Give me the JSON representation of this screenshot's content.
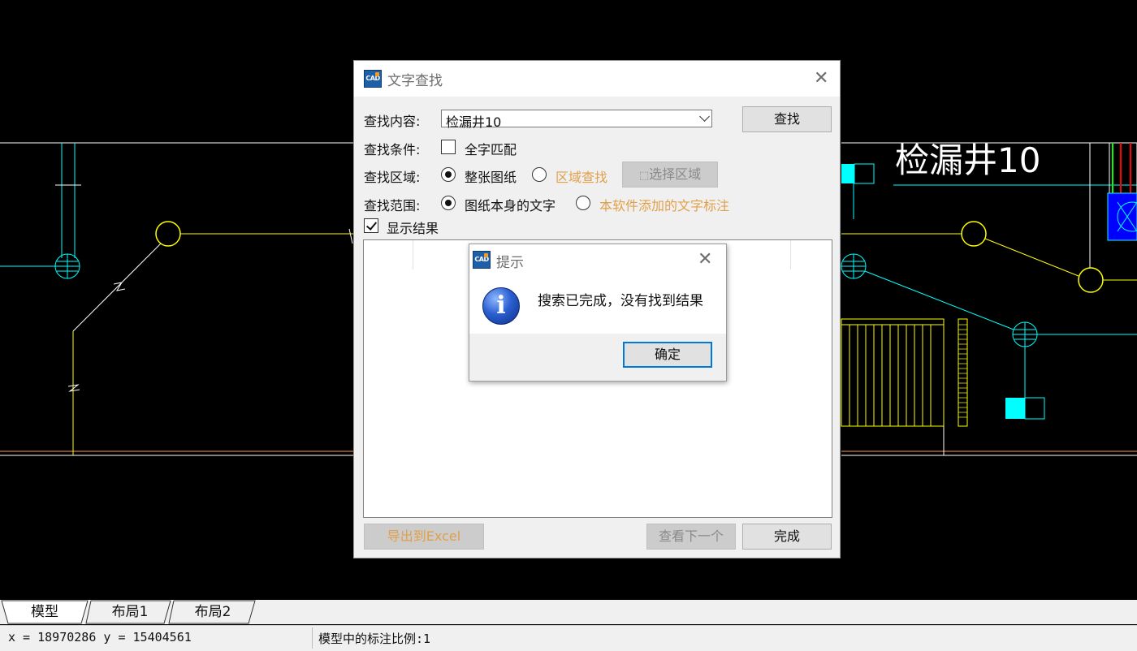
{
  "drawing": {
    "label": "检漏井10",
    "colors": {
      "white": "#ffffff",
      "cyan": "#00ffff",
      "yellow": "#ffff00",
      "orange": "#ff9955",
      "red": "#ff0000",
      "blue": "#0000ff",
      "green": "#00ff00"
    }
  },
  "find_dialog": {
    "title": "文字查找",
    "logo_text": "CAD",
    "close_icon": "close-icon",
    "search_content_label": "查找内容:",
    "search_value": "检漏井10",
    "search_button": "查找",
    "condition_label": "查找条件:",
    "whole_word_label": "全字匹配",
    "whole_word_checked": false,
    "area_label": "查找区域:",
    "area_options": [
      {
        "label": "整张图纸",
        "selected": true
      },
      {
        "label": "区域查找",
        "selected": false
      }
    ],
    "select_area_button": "选择区域",
    "scope_label": "查找范围:",
    "scope_options": [
      {
        "label": "图纸本身的文字",
        "selected": true
      },
      {
        "label": "本软件添加的文字标注",
        "selected": false
      }
    ],
    "show_results_label": "显示结果",
    "show_results_checked": true,
    "export_button": "导出到Excel",
    "next_button": "查看下一个",
    "done_button": "完成"
  },
  "message_box": {
    "title": "提示",
    "message": "搜索已完成，没有找到结果",
    "ok_button": "确定",
    "icon": "info-icon"
  },
  "tabs": [
    {
      "label": "模型",
      "active": true
    },
    {
      "label": "布局1",
      "active": false
    },
    {
      "label": "布局2",
      "active": false
    }
  ],
  "status": {
    "coords": "x = 18970286  y = 15404561",
    "scale": "模型中的标注比例:1"
  }
}
